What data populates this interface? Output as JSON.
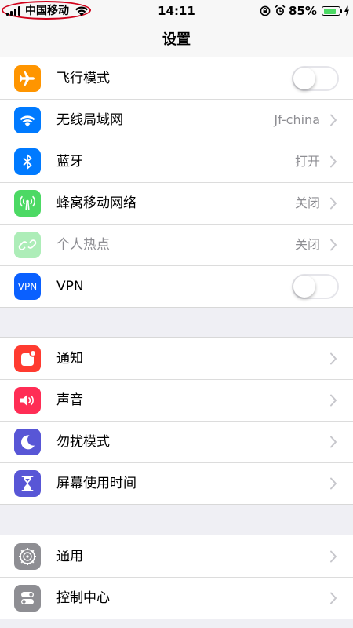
{
  "status_bar": {
    "carrier": "中国移动",
    "time": "14:11",
    "battery_percent": "85%",
    "battery_level": 0.85,
    "icons": [
      "signal-icon",
      "wifi-icon",
      "rotation-lock-icon",
      "alarm-icon",
      "battery-icon",
      "charging-icon"
    ]
  },
  "nav": {
    "title": "设置"
  },
  "group1": [
    {
      "label": "飞行模式",
      "icon": "airplane-icon",
      "color": "#ff9500",
      "control": "toggle",
      "on": false
    },
    {
      "label": "无线局域网",
      "icon": "wifi-icon",
      "color": "#007aff",
      "value": "Jf-china"
    },
    {
      "label": "蓝牙",
      "icon": "bluetooth-icon",
      "color": "#007aff",
      "value": "打开"
    },
    {
      "label": "蜂窝移动网络",
      "icon": "cellular-icon",
      "color": "#4cd964",
      "value": "关闭"
    },
    {
      "label": "个人热点",
      "icon": "hotspot-icon",
      "color": "#4cd964",
      "value": "关闭",
      "disabled": true
    },
    {
      "label": "VPN",
      "icon": "vpn-icon",
      "icon_text": "VPN",
      "color": "#0a60ff",
      "control": "toggle",
      "on": false
    }
  ],
  "group2": [
    {
      "label": "通知",
      "icon": "notifications-icon",
      "color": "#ff3b30"
    },
    {
      "label": "声音",
      "icon": "sound-icon",
      "color": "#ff2d55"
    },
    {
      "label": "勿扰模式",
      "icon": "moon-icon",
      "color": "#5856d6"
    },
    {
      "label": "屏幕使用时间",
      "icon": "hourglass-icon",
      "color": "#5856d6"
    }
  ],
  "group3": [
    {
      "label": "通用",
      "icon": "gear-icon",
      "color": "#8e8e93"
    },
    {
      "label": "控制中心",
      "icon": "control-center-icon",
      "color": "#8e8e93"
    }
  ]
}
